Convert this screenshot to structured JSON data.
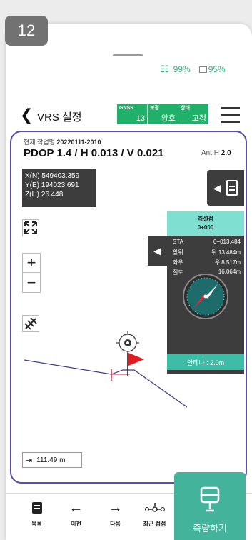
{
  "step_number": "12",
  "status_bar": {
    "signal": "99%",
    "battery": "95%"
  },
  "header": {
    "title": "VRS 설정",
    "gnss": {
      "label": "GNSS",
      "value": "13"
    },
    "correction": {
      "label": "보정",
      "value": "양호"
    },
    "state": {
      "label": "상태",
      "value": "고정"
    }
  },
  "info": {
    "job_prefix": "현재 작업명",
    "job_name": "20220111-2010",
    "dop_text": "PDOP 1.4 / H 0.013 / V 0.021",
    "ant_h_label": "Ant.H",
    "ant_h_value": "2.0"
  },
  "coords": {
    "x": "X(N) 549403.359",
    "y": "Y(E) 194023.691",
    "z": "Z(H) 26.448"
  },
  "stake_panel": {
    "title": "측설점",
    "station_id": "0+000",
    "rows": [
      {
        "label": "STA",
        "value": "0+013.484"
      },
      {
        "label": "앞뒤",
        "value": "뒤 13.484m"
      },
      {
        "label": "좌우",
        "value": "우 8.517m"
      },
      {
        "label": "절토",
        "value": "16.064m"
      }
    ],
    "antenna_label": "안테나 : 2.0m"
  },
  "scale": "111.49 m",
  "bottom_nav": [
    {
      "label": "목록",
      "icon": "list-icon"
    },
    {
      "label": "이전",
      "icon": "arrow-left-icon"
    },
    {
      "label": "다음",
      "icon": "arrow-right-icon"
    },
    {
      "label": "최근 접점",
      "icon": "nearest-point-icon"
    }
  ],
  "measure_button": {
    "label": "측량하기",
    "icon": "gnss-receiver-icon"
  },
  "colors": {
    "accent_green": "#20b06a",
    "teal": "#43b49b",
    "panel_dark": "#3d3d3d",
    "frame_purple": "#5b4db2",
    "stake_head": "#7fe0d2"
  }
}
